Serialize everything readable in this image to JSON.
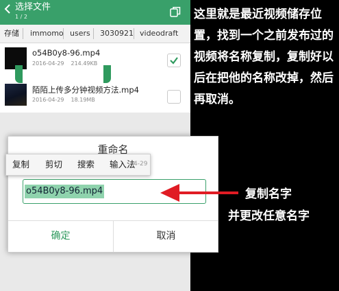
{
  "header": {
    "title": "选择文件",
    "count": "1 / 2",
    "back_icon": "back-arrow-icon",
    "action_icon": "copy-icon"
  },
  "breadcrumb": [
    "存储",
    "immomo",
    "users",
    "3030921",
    "videodraft"
  ],
  "files": [
    {
      "name": "o54B0y8-96.mp4",
      "date": "2016-04-29",
      "size": "214.49KB",
      "checked": true
    },
    {
      "name": "陌陌上传多分钟视频方法.mp4",
      "date": "2016-04-29",
      "size": "18.19MB",
      "checked": false
    }
  ],
  "dialog": {
    "title": "重命名",
    "field_value": "o54B0y8-96.mp4",
    "ok_label": "确定",
    "cancel_label": "取消",
    "faded_text": "4-29"
  },
  "context_menu": [
    "复制",
    "剪切",
    "搜索",
    "输入法"
  ],
  "annotation": {
    "caption": "这里就是最近视频储存位置，找到一个之前发布过的视频将名称复制，复制好以后在把他的名称改掉，然后再取消。",
    "arrow_label_1": "复制名字",
    "arrow_label_2": "并更改任意名字"
  },
  "colors": {
    "accent": "#39a06a",
    "arrow": "#e01c24",
    "background": "#000000"
  }
}
